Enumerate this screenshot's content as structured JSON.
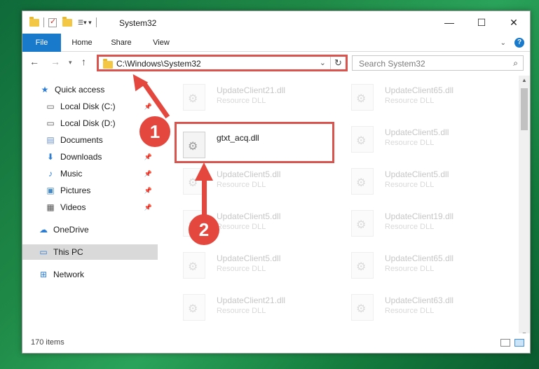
{
  "window": {
    "title": "System32",
    "controls": {
      "minimize": "—",
      "maximize": "☐",
      "close": "✕"
    }
  },
  "ribbon": {
    "tabs": [
      "File",
      "Home",
      "Share",
      "View"
    ],
    "expand_icon": "chevron-down-icon",
    "help_label": "?"
  },
  "navbar": {
    "address": "C:\\Windows\\System32",
    "search_placeholder": "Search System32"
  },
  "sidebar": {
    "items": [
      {
        "label": "Quick access",
        "icon": "star-icon",
        "pinned": false
      },
      {
        "label": "Local Disk (C:)",
        "icon": "drive-icon",
        "pinned": true
      },
      {
        "label": "Local Disk (D:)",
        "icon": "drive-icon",
        "pinned": false
      },
      {
        "label": "Documents",
        "icon": "documents-icon",
        "pinned": true
      },
      {
        "label": "Downloads",
        "icon": "download-icon",
        "pinned": true
      },
      {
        "label": "Music",
        "icon": "music-icon",
        "pinned": true
      },
      {
        "label": "Pictures",
        "icon": "pictures-icon",
        "pinned": true
      },
      {
        "label": "Videos",
        "icon": "videos-icon",
        "pinned": true
      },
      {
        "label": "OneDrive",
        "icon": "cloud-icon",
        "pinned": false
      },
      {
        "label": "This PC",
        "icon": "computer-icon",
        "pinned": false,
        "selected": true
      },
      {
        "label": "Network",
        "icon": "network-icon",
        "pinned": false
      }
    ]
  },
  "files": [
    {
      "name": "UpdateClient21.dll",
      "type": "Resource DLL"
    },
    {
      "name": "UpdateClient65.dll",
      "type": "Resource DLL"
    },
    {
      "name": "gtxt_acq.dll",
      "type": ""
    },
    {
      "name": "UpdateClient5.dll",
      "type": "Resource DLL"
    },
    {
      "name": "UpdateClient5.dll",
      "type": "Resource DLL"
    },
    {
      "name": "UpdateClient5.dll",
      "type": "Resource DLL"
    },
    {
      "name": "UpdateClient5.dll",
      "type": "Resource DLL"
    },
    {
      "name": "UpdateClient19.dll",
      "type": "Resource DLL"
    },
    {
      "name": "UpdateClient5.dll",
      "type": "Resource DLL"
    },
    {
      "name": "UpdateClient65.dll",
      "type": "Resource DLL"
    },
    {
      "name": "UpdateClient21.dll",
      "type": "Resource DLL"
    },
    {
      "name": "UpdateClient63.dll",
      "type": "Resource DLL"
    }
  ],
  "status": {
    "item_count": "170 items"
  },
  "annotations": {
    "step1": "1",
    "step2": "2",
    "color": "#e3473d"
  }
}
